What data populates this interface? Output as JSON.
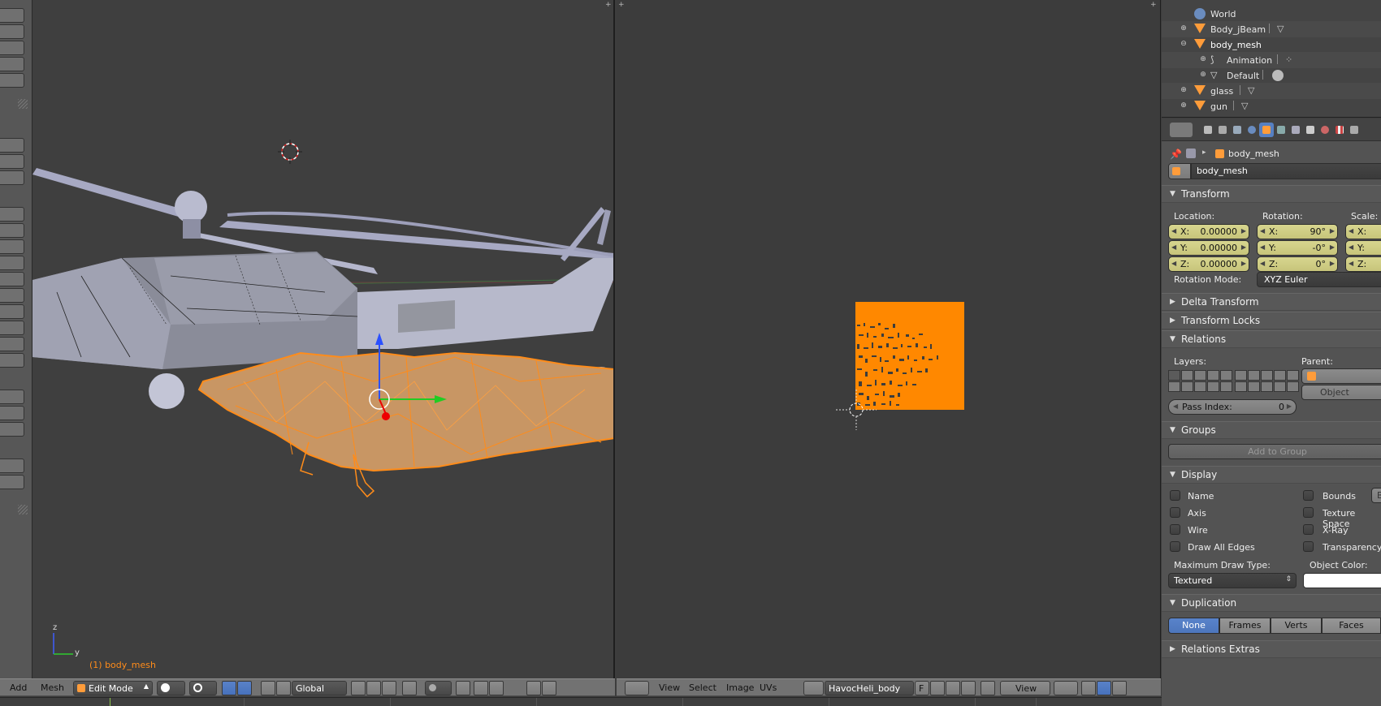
{
  "outliner": {
    "items": [
      {
        "label": "World",
        "icon": "world-icon",
        "depth": 0
      },
      {
        "label": "Body_jBeam",
        "icon": "object-icon",
        "depth": 0
      },
      {
        "label": "body_mesh",
        "icon": "object-icon",
        "depth": 0
      },
      {
        "label": "Animation",
        "icon": "armature-icon",
        "depth": 1
      },
      {
        "label": "Default",
        "icon": "mesh-icon",
        "depth": 1
      },
      {
        "label": "glass",
        "icon": "object-icon",
        "depth": 0
      },
      {
        "label": "gun",
        "icon": "object-icon",
        "depth": 0
      }
    ]
  },
  "properties": {
    "breadcrumb": "body_mesh",
    "object_name": "body_mesh",
    "transform": {
      "title": "Transform",
      "location_label": "Location:",
      "rotation_label": "Rotation:",
      "scale_label": "Scale:",
      "location": [
        {
          "axis": "X:",
          "value": "0.00000"
        },
        {
          "axis": "Y:",
          "value": "0.00000"
        },
        {
          "axis": "Z:",
          "value": "0.00000"
        }
      ],
      "rotation": [
        {
          "axis": "X:",
          "value": "90°"
        },
        {
          "axis": "Y:",
          "value": "-0°"
        },
        {
          "axis": "Z:",
          "value": "0°"
        }
      ],
      "scale": [
        {
          "axis": "X:"
        },
        {
          "axis": "Y:"
        },
        {
          "axis": "Z:"
        }
      ],
      "rotation_mode_label": "Rotation Mode:",
      "rotation_mode": "XYZ Euler"
    },
    "delta_transform": "Delta Transform",
    "transform_locks": "Transform Locks",
    "relations": {
      "title": "Relations",
      "layers_label": "Layers:",
      "parent_label": "Parent:",
      "parent_type": "Object",
      "pass_index_label": "Pass Index:",
      "pass_index": "0"
    },
    "groups": {
      "title": "Groups",
      "add_to_group": "Add to Group"
    },
    "display": {
      "title": "Display",
      "left": [
        "Name",
        "Axis",
        "Wire",
        "Draw All Edges"
      ],
      "right": [
        "Bounds",
        "Texture Space",
        "X-Ray",
        "Transparency"
      ],
      "bounds_btn": "B",
      "max_draw_type_label": "Maximum Draw Type:",
      "max_draw_type": "Textured",
      "object_color_label": "Object Color:"
    },
    "duplication": {
      "title": "Duplication",
      "options": [
        "None",
        "Frames",
        "Verts",
        "Faces"
      ],
      "active": "None"
    },
    "relations_extras": "Relations Extras"
  },
  "view3d": {
    "object_label": "(1) body_mesh",
    "axis_z": "z",
    "axis_y": "y",
    "header": {
      "add": "Add",
      "mesh": "Mesh",
      "mode": "Edit Mode",
      "orientation": "Global"
    }
  },
  "uv_editor": {
    "header": {
      "view": "View",
      "select": "Select",
      "image": "Image",
      "uvs": "UVs",
      "image_name": "HavocHeli_body",
      "fake_user": "F",
      "view_menu": "View"
    }
  },
  "colors": {
    "selection": "#ff8c1a",
    "active_tab": "#5680c2",
    "number_field": "#d2d088"
  }
}
